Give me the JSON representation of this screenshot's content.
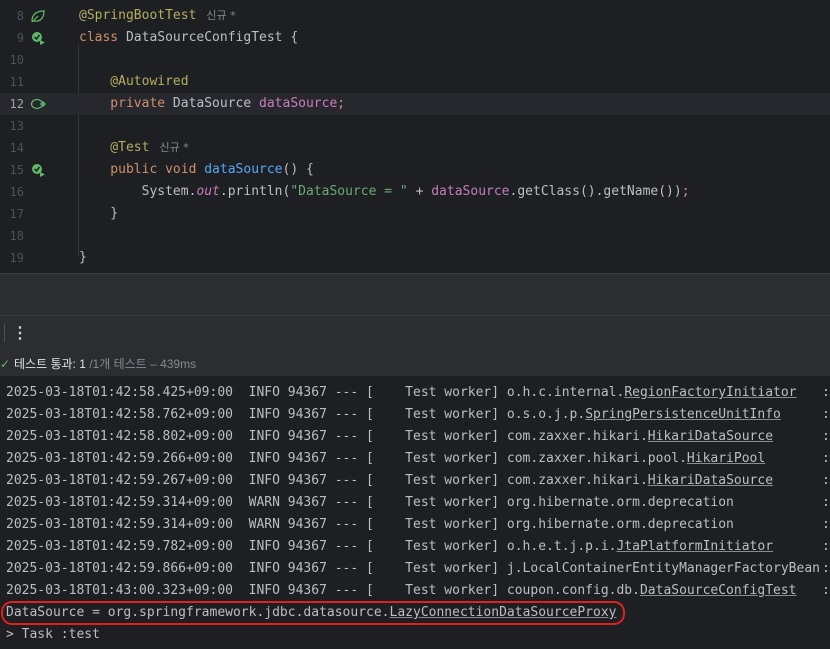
{
  "editor": {
    "lines": [
      {
        "num": "8",
        "parts": [
          {
            "t": "@SpringBootTest",
            "c": "ann"
          }
        ],
        "hint": "신규 *",
        "icon": "spring-leaf-icon"
      },
      {
        "num": "9",
        "parts": [
          {
            "t": "class ",
            "c": "kw"
          },
          {
            "t": "DataSourceConfigTest {",
            "c": "plain"
          }
        ],
        "icon": "run-test-icon"
      },
      {
        "num": "10",
        "parts": []
      },
      {
        "num": "11",
        "parts": [
          {
            "t": "    @Autowired",
            "c": "ann"
          }
        ]
      },
      {
        "num": "12",
        "parts": [
          {
            "t": "    private ",
            "c": "kw"
          },
          {
            "t": "DataSource ",
            "c": "plain"
          },
          {
            "t": "dataSource",
            "c": "fld"
          },
          {
            "t": ";",
            "c": "kw"
          }
        ],
        "icon": "bean-navigation-icon",
        "current": true
      },
      {
        "num": "13",
        "parts": []
      },
      {
        "num": "14",
        "parts": [
          {
            "t": "    @Test",
            "c": "ann"
          }
        ],
        "hint": "신규 *"
      },
      {
        "num": "15",
        "parts": [
          {
            "t": "    public void ",
            "c": "kw"
          },
          {
            "t": "dataSource",
            "c": "fn"
          },
          {
            "t": "() {",
            "c": "plain"
          }
        ],
        "icon": "run-test-icon"
      },
      {
        "num": "16",
        "parts": [
          {
            "t": "        System.",
            "c": "plain"
          },
          {
            "t": "out",
            "c": "stat"
          },
          {
            "t": ".println(",
            "c": "plain"
          },
          {
            "t": "\"DataSource = \"",
            "c": "str"
          },
          {
            "t": " + ",
            "c": "plain"
          },
          {
            "t": "dataSource",
            "c": "fld"
          },
          {
            "t": ".getClass().getName())",
            "c": "plain"
          },
          {
            "t": ";",
            "c": "kw"
          }
        ]
      },
      {
        "num": "17",
        "parts": [
          {
            "t": "    }",
            "c": "plain"
          }
        ]
      },
      {
        "num": "18",
        "parts": []
      },
      {
        "num": "19",
        "parts": [
          {
            "t": "}",
            "c": "plain"
          }
        ]
      }
    ]
  },
  "status": {
    "label": "테스트 통과: ",
    "count": "1",
    "sub": " /1개 테스트 – 439ms"
  },
  "console": {
    "lines": [
      {
        "pre": "2025-03-18T01:42:58.425+09:00  INFO 94367 --- [    Test worker] o.h.c.internal.",
        "link": "RegionFactoryInitiator"
      },
      {
        "pre": "2025-03-18T01:42:58.762+09:00  INFO 94367 --- [    Test worker] o.s.o.j.p.",
        "link": "SpringPersistenceUnitInfo"
      },
      {
        "pre": "2025-03-18T01:42:58.802+09:00  INFO 94367 --- [    Test worker] com.zaxxer.hikari.",
        "link": "HikariDataSource"
      },
      {
        "pre": "2025-03-18T01:42:59.266+09:00  INFO 94367 --- [    Test worker] com.zaxxer.hikari.pool.",
        "link": "HikariPool"
      },
      {
        "pre": "2025-03-18T01:42:59.267+09:00  INFO 94367 --- [    Test worker] com.zaxxer.hikari.",
        "link": "HikariDataSource"
      },
      {
        "pre": "2025-03-18T01:42:59.314+09:00  WARN 94367 --- [    Test worker] org.hibernate.orm.deprecation",
        "link": ""
      },
      {
        "pre": "2025-03-18T01:42:59.314+09:00  WARN 94367 --- [    Test worker] org.hibernate.orm.deprecation",
        "link": ""
      },
      {
        "pre": "2025-03-18T01:42:59.782+09:00  INFO 94367 --- [    Test worker] o.h.e.t.j.p.i.",
        "link": "JtaPlatformInitiator"
      },
      {
        "pre": "2025-03-18T01:42:59.866+09:00  INFO 94367 --- [    Test worker] j.LocalContainerEntityManagerFactoryBean",
        "link": ""
      },
      {
        "pre": "2025-03-18T01:43:00.323+09:00  INFO 94367 --- [    Test worker] coupon.config.db.",
        "link": "DataSourceConfigTest"
      },
      {
        "pre": "DataSource = org.springframework.jdbc.datasource.",
        "link": "LazyConnectionDataSourceProxy"
      },
      {
        "pre": "> Task :test",
        "link": ""
      }
    ],
    "tail_mark": ":"
  },
  "colors": {
    "highlight": "#e0221f",
    "pass": "#5fb865"
  }
}
